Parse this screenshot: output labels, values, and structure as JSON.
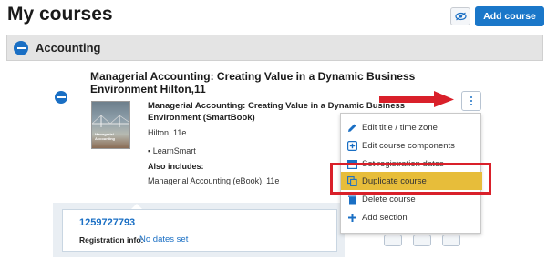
{
  "page": {
    "title": "My courses"
  },
  "toolbar": {
    "add_course_label": "Add course",
    "eye_icon": "eye-icon"
  },
  "section": {
    "label": "Accounting"
  },
  "course": {
    "title": "Managerial Accounting: Creating Value in a Dynamic Business Environment Hilton,11",
    "product_title": "Managerial Accounting: Creating Value in a Dynamic Business Environment (SmartBook)",
    "author_edition": "Hilton, 11e",
    "learnsmart": "LearnSmart",
    "also_includes_label": "Also includes:",
    "ebook": "Managerial Accounting (eBook), 11e",
    "cover_text": "Managerial Accounting"
  },
  "menu": {
    "items": [
      {
        "label": "Edit title / time zone",
        "icon": "pencil-icon"
      },
      {
        "label": "Edit course components",
        "icon": "plus-box-icon"
      },
      {
        "label": "Set registration dates",
        "icon": "calendar-icon"
      },
      {
        "label": "Duplicate course",
        "icon": "duplicate-icon"
      },
      {
        "label": "Delete course",
        "icon": "trash-icon"
      },
      {
        "label": "Add section",
        "icon": "plus-icon"
      }
    ],
    "highlight_color": "#e7bd3a"
  },
  "section_card": {
    "section_number": "1259727793",
    "registration_label": "Registration info:",
    "registration_value": "No dates set"
  },
  "colors": {
    "accent": "#1a77c9",
    "annotation": "#d9202a"
  }
}
